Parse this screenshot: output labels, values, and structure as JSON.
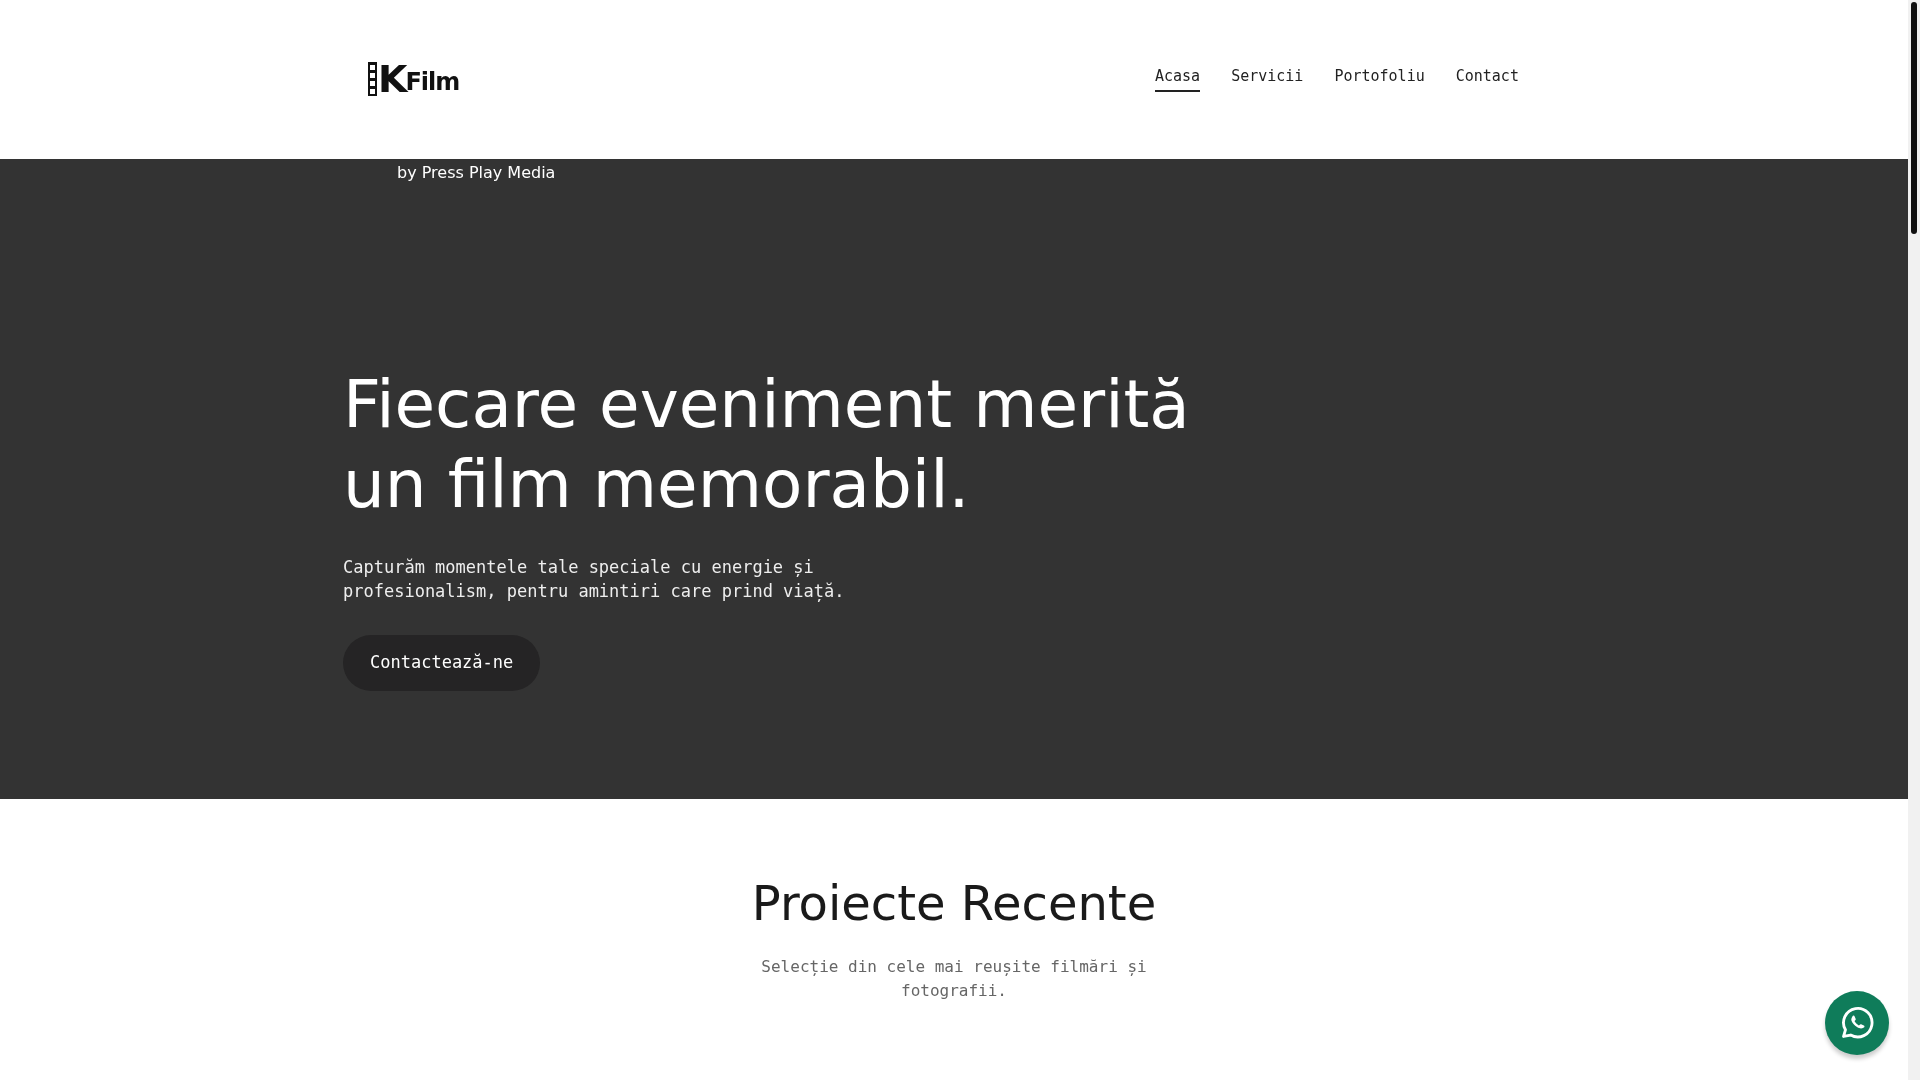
{
  "header": {
    "logo": {
      "mark": "K",
      "name": "Film"
    },
    "nav": [
      {
        "label": "Acasa",
        "selected": true
      },
      {
        "label": "Servicii",
        "selected": false
      },
      {
        "label": "Portofoliu",
        "selected": false
      },
      {
        "label": "Contact",
        "selected": false
      }
    ]
  },
  "hero": {
    "tagline": "by Press Play Media",
    "title_lines": [
      "Fiecare eveniment merită",
      "un film memorabil."
    ],
    "text": "Capturăm momentele tale speciale cu energie și profesionalism, pentru amintiri care prind viață.",
    "button": "Contactează-ne"
  },
  "projects": {
    "title": "Proiecte Recente",
    "subtitle": "Selecție din cele mai reușite filmări și fotografii."
  }
}
